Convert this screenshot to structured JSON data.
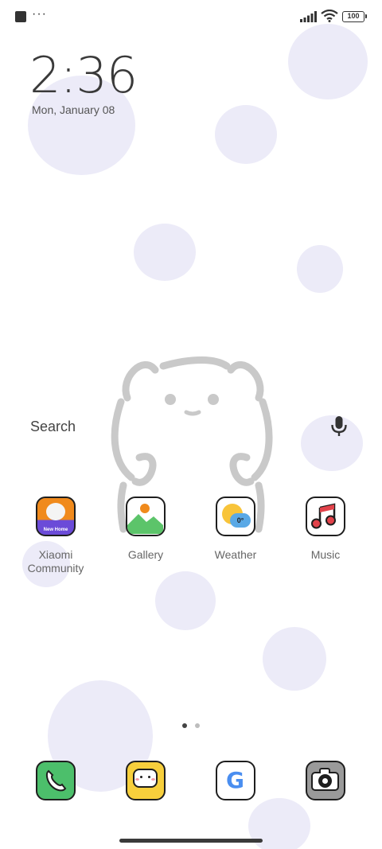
{
  "status_bar": {
    "more_indicator": "···",
    "battery_level": "100"
  },
  "clock": {
    "time": "2:36",
    "date": "Mon, January 08"
  },
  "search": {
    "label": "Search"
  },
  "apps": [
    {
      "label": "Xiaomi Community",
      "icon": "xiaomi-community-icon",
      "badge": "New Home"
    },
    {
      "label": "Gallery",
      "icon": "gallery-icon"
    },
    {
      "label": "Weather",
      "icon": "weather-icon",
      "temp": "0°"
    },
    {
      "label": "Music",
      "icon": "music-icon"
    }
  ],
  "dock": [
    {
      "icon": "phone-icon"
    },
    {
      "icon": "messages-icon"
    },
    {
      "icon": "google-icon",
      "glyph": "G"
    },
    {
      "icon": "camera-icon"
    }
  ],
  "pages": {
    "count": 2,
    "current": 1
  },
  "colors": {
    "blob": "#ecebf8",
    "community_orange": "#f08a1c",
    "community_purple": "#6b4bd8",
    "gallery_green": "#5cc46a",
    "weather_yellow": "#f8c43a",
    "weather_blue": "#5aa9e6",
    "music_red": "#e2424a",
    "phone_green": "#4cbf6b",
    "messages_yellow": "#f7cf3c",
    "google_blue": "#4a8ef0",
    "camera_gray": "#9a9a9a"
  }
}
